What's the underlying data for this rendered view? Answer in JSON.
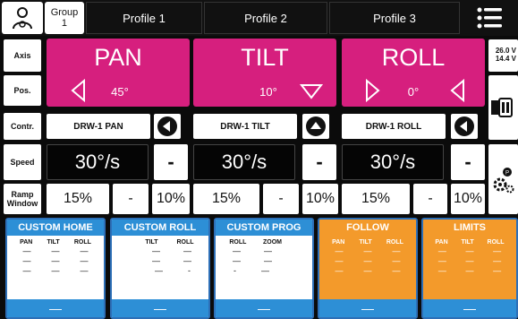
{
  "topbar": {
    "group_label": "Group\n1",
    "tabs": [
      {
        "label": "Profile 1",
        "active": true
      },
      {
        "label": "Profile 2",
        "active": false
      },
      {
        "label": "Profile 3",
        "active": false
      }
    ]
  },
  "row_labels": {
    "axis": "Axis",
    "pos": "Pos.",
    "contr": "Contr.",
    "speed": "Speed",
    "ramp": "Ramp\nWindow"
  },
  "axes": [
    {
      "name": "PAN",
      "position": "45°",
      "controller": "DRW-1 PAN",
      "speed": "30°/s",
      "minus": "-",
      "ramp": "15%",
      "ramp_minus": "-",
      "ramp_window": "10%"
    },
    {
      "name": "TILT",
      "position": "10°",
      "controller": "DRW-1 TILT",
      "speed": "30°/s",
      "minus": "-",
      "ramp": "15%",
      "ramp_minus": "-",
      "ramp_window": "10%"
    },
    {
      "name": "ROLL",
      "position": "0°",
      "controller": "DRW-1 ROLL",
      "speed": "30°/s",
      "minus": "-",
      "ramp": "15%",
      "ramp_minus": "-",
      "ramp_window": "10%"
    }
  ],
  "side": {
    "voltage_1": "26.0 V",
    "voltage_2": "14.4 V"
  },
  "panels": [
    {
      "title": "CUSTOM HOME",
      "cols": [
        "PAN",
        "TILT",
        "ROLL"
      ],
      "rows": [
        [
          "—",
          "—",
          "—"
        ],
        [
          "—",
          "—",
          "—"
        ],
        [
          "—",
          "—",
          "—"
        ]
      ],
      "footer": "—",
      "style": "white"
    },
    {
      "title": "CUSTOM ROLL",
      "cols": [
        "",
        "TILT",
        "ROLL"
      ],
      "rows": [
        [
          "",
          "—",
          "—"
        ],
        [
          "",
          "—",
          "—"
        ],
        [
          "",
          "—",
          "-"
        ]
      ],
      "footer": "—",
      "style": "white"
    },
    {
      "title": "CUSTOM PROG",
      "cols": [
        "ROLL",
        "ZOOM",
        ""
      ],
      "rows": [
        [
          "—",
          "—",
          ""
        ],
        [
          "—",
          "—",
          ""
        ],
        [
          "-",
          "—",
          ""
        ]
      ],
      "footer": "—",
      "style": "white"
    },
    {
      "title": "FOLLOW",
      "cols": [
        "PAN",
        "TILT",
        "ROLL"
      ],
      "rows": [
        [
          "—",
          "—",
          "—"
        ],
        [
          "—",
          "—",
          "—"
        ],
        [
          "—",
          "—",
          "—"
        ]
      ],
      "footer": "—",
      "style": "orange"
    },
    {
      "title": "LIMITS",
      "cols": [
        "PAN",
        "TILT",
        "ROLL"
      ],
      "rows": [
        [
          "—",
          "—",
          "—"
        ],
        [
          "—",
          "—",
          "—"
        ],
        [
          "—",
          "—",
          "—"
        ]
      ],
      "footer": "—",
      "style": "orange"
    }
  ],
  "colors": {
    "axis_panel": "#d61f7e",
    "active_tab": "#1f8a3c",
    "panel_blue": "#2d8fd6",
    "panel_orange": "#f39a2b"
  }
}
